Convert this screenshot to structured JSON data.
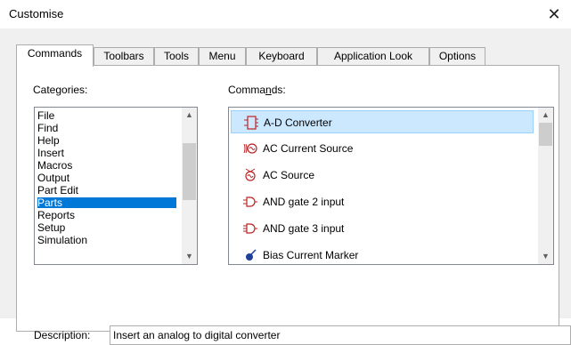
{
  "window": {
    "title": "Customise"
  },
  "tabs": [
    {
      "label": "Commands",
      "active": true
    },
    {
      "label": "Toolbars",
      "active": false
    },
    {
      "label": "Tools",
      "active": false
    },
    {
      "label": "Menu",
      "active": false
    },
    {
      "label": "Keyboard",
      "active": false
    },
    {
      "label": "Application Look",
      "active": false
    },
    {
      "label": "Options",
      "active": false
    }
  ],
  "categories": {
    "label": "Categories:",
    "items": [
      "File",
      "Find",
      "Help",
      "Insert",
      "Macros",
      "Output",
      "Part Edit",
      "Parts",
      "Reports",
      "Setup",
      "Simulation"
    ],
    "selected": "Parts"
  },
  "commands": {
    "label": "Commands:",
    "items": [
      {
        "label": "A-D Converter",
        "icon": "adc-icon",
        "selected": true
      },
      {
        "label": "AC Current Source",
        "icon": "ac-current-source-icon",
        "selected": false
      },
      {
        "label": "AC Source",
        "icon": "ac-source-icon",
        "selected": false
      },
      {
        "label": "AND gate 2 input",
        "icon": "and-gate-icon",
        "selected": false
      },
      {
        "label": "AND gate 3 input",
        "icon": "and-gate-3-icon",
        "selected": false
      },
      {
        "label": "Bias Current Marker",
        "icon": "bias-marker-icon",
        "selected": false
      }
    ]
  },
  "description": {
    "label": "Description:",
    "value": "Insert an analog to digital converter"
  },
  "colors": {
    "selection": "#0078d7",
    "command_selection": "#cce8ff",
    "command_border": "#99d1ff"
  }
}
